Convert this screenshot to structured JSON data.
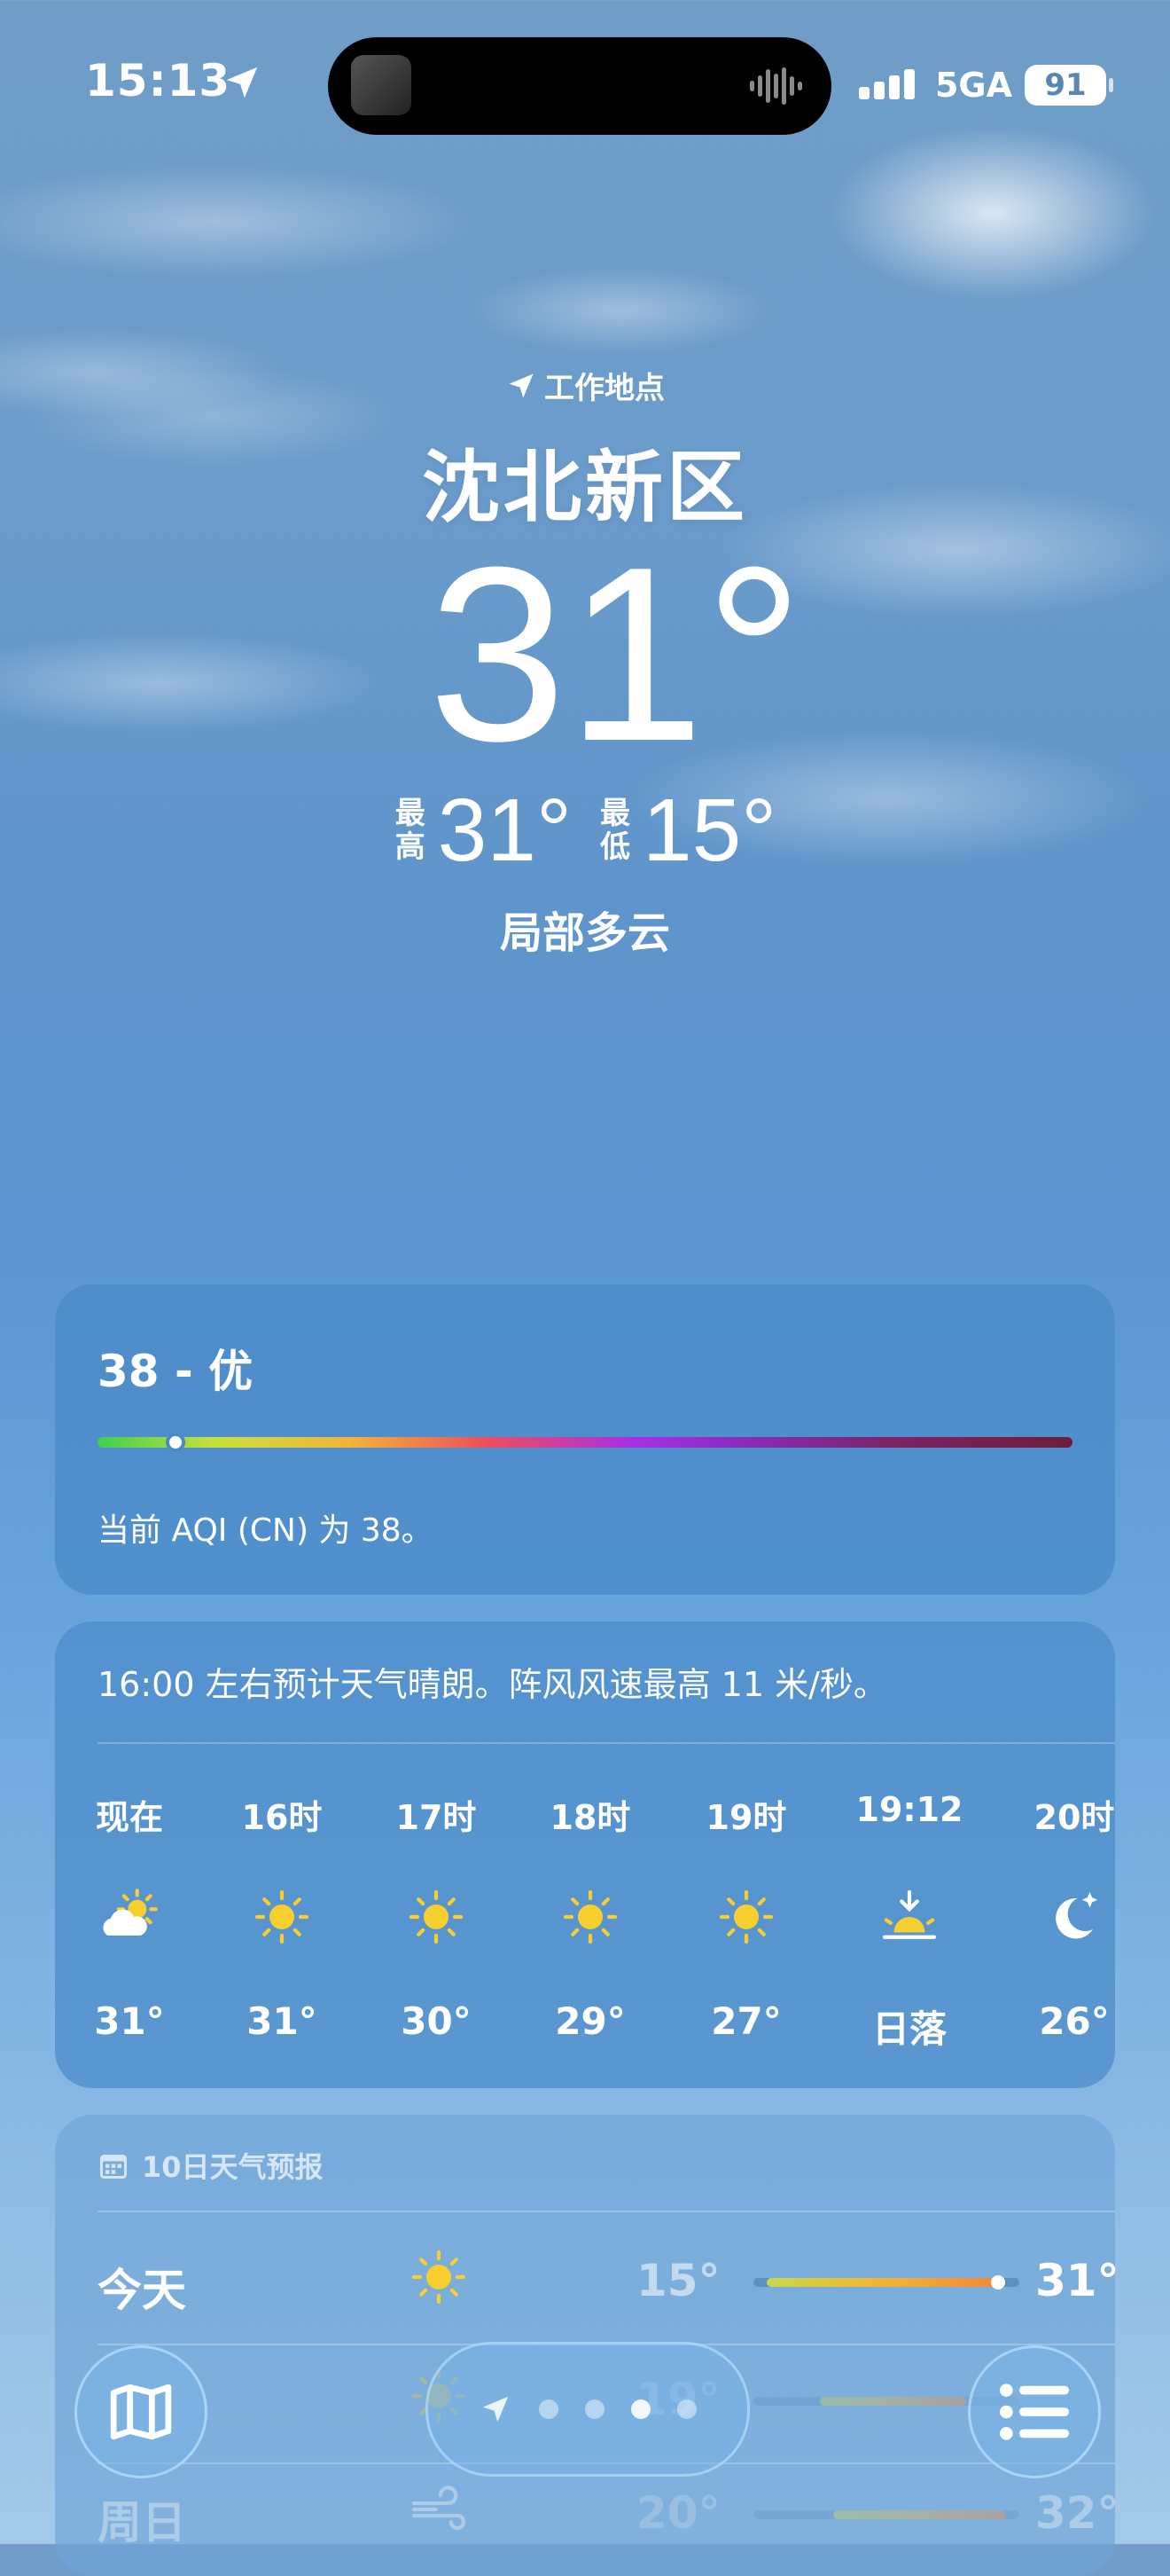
{
  "status_bar": {
    "time": "15:13",
    "network": "5GA",
    "battery": "91"
  },
  "header": {
    "location_label": "工作地点",
    "city": "沈北新区",
    "temperature": "31°",
    "high_label": "最高",
    "high": "31°",
    "low_label": "最低",
    "low": "15°",
    "condition": "局部多云"
  },
  "aqi": {
    "title": "38 - 优",
    "description": "当前 AQI (CN) 为 38。",
    "level": 0.08
  },
  "hourly": {
    "summary": "16:00 左右预计天气晴朗。阵风风速最高 11 米/秒。",
    "items": [
      {
        "label": "现在",
        "icon": "partly-cloudy-icon",
        "temp": "31°"
      },
      {
        "label": "16时",
        "icon": "sun-icon",
        "temp": "31°"
      },
      {
        "label": "17时",
        "icon": "sun-icon",
        "temp": "30°"
      },
      {
        "label": "18时",
        "icon": "sun-icon",
        "temp": "29°"
      },
      {
        "label": "19时",
        "icon": "sun-icon",
        "temp": "27°"
      },
      {
        "label": "19:12",
        "icon": "sunset-icon",
        "temp": "日落"
      },
      {
        "label": "20时",
        "icon": "moon-stars-icon",
        "temp": "26°"
      }
    ]
  },
  "daily": {
    "title": "10日天气预报",
    "days": [
      {
        "day": "今天",
        "icon": "sun-icon",
        "low": "15°",
        "high": "31°"
      },
      {
        "day": "",
        "icon": "sun-icon",
        "low": "19°",
        "high": ""
      },
      {
        "day": "周日",
        "icon": "wind-icon",
        "low": "20°",
        "high": "32°"
      }
    ]
  },
  "colors": {
    "sun": "#f7cf2f",
    "aqi_good": "#3fcf52"
  },
  "bottom_bar": {
    "pages": 4,
    "active_page": 3
  }
}
